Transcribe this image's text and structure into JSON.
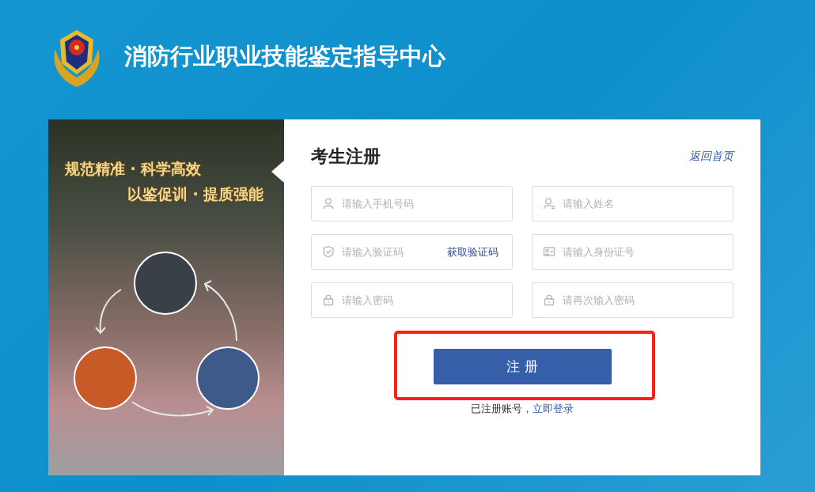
{
  "header": {
    "title": "消防行业职业技能鉴定指导中心"
  },
  "banner": {
    "slogans": [
      "规范精准 · 科学高效",
      "以鉴促训 · 提质强能"
    ]
  },
  "form": {
    "title": "考生注册",
    "back_link": "返回首页",
    "fields": [
      {
        "kind": "phone",
        "placeholder": "请输入手机号码"
      },
      {
        "kind": "name",
        "placeholder": "请输入姓名"
      },
      {
        "kind": "code",
        "placeholder": "请输入验证码",
        "action": "获取验证码"
      },
      {
        "kind": "idnumber",
        "placeholder": "请输入身份证号"
      },
      {
        "kind": "password",
        "placeholder": "请输入密码"
      },
      {
        "kind": "password",
        "placeholder": "请再次输入密码"
      }
    ],
    "submit": {
      "label": "注 册",
      "highlighted": true
    },
    "login_prompt": "已注册账号，",
    "login_link": "立即登录"
  }
}
